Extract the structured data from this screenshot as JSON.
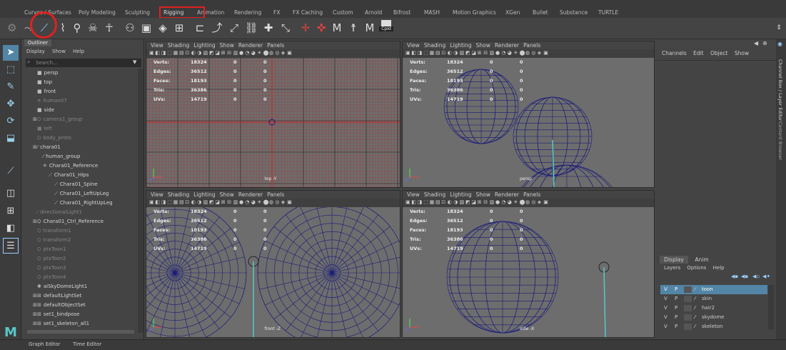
{
  "shelf_tabs": [
    "Curves / Surfaces",
    "Poly Modeling",
    "Sculpting",
    "Rigging",
    "Animation",
    "Rendering",
    "FX",
    "FX Caching",
    "Custom",
    "Arnold",
    "Bifrost",
    "MASH",
    "Motion Graphics",
    "XGen",
    "Bullet",
    "Substance",
    "TURTLE"
  ],
  "shelf_icons": {
    "cp_label": "CpId"
  },
  "outliner": {
    "tab": "Outliner",
    "menu": [
      "Display",
      "Show",
      "Help"
    ],
    "search_placeholder": "Search...",
    "items": [
      {
        "label": "persp",
        "dim": false,
        "indent": 1
      },
      {
        "label": "top",
        "dim": false,
        "indent": 1
      },
      {
        "label": "front",
        "dim": false,
        "indent": 1
      },
      {
        "label": "human07",
        "dim": true,
        "indent": 1
      },
      {
        "label": "side",
        "dim": false,
        "indent": 1
      },
      {
        "label": "camera1_group",
        "dim": true,
        "indent": 1
      },
      {
        "label": "left",
        "dim": true,
        "indent": 1
      },
      {
        "label": "body_proto",
        "dim": true,
        "indent": 1
      },
      {
        "label": "chara01",
        "dim": false,
        "indent": 1
      },
      {
        "label": "human_group",
        "dim": false,
        "indent": 2
      },
      {
        "label": "Chara01_Reference",
        "dim": false,
        "indent": 2
      },
      {
        "label": "Chara01_Hips",
        "dim": false,
        "indent": 3
      },
      {
        "label": "Chara01_Spine",
        "dim": false,
        "indent": 4
      },
      {
        "label": "Chara01_LeftUpLeg",
        "dim": false,
        "indent": 4
      },
      {
        "label": "Chara01_RightUpLeg",
        "dim": false,
        "indent": 4
      },
      {
        "label": "directionalLight1",
        "dim": true,
        "indent": 1
      },
      {
        "label": "Chara01_Ctrl_Reference",
        "dim": false,
        "indent": 1
      },
      {
        "label": "transform1",
        "dim": true,
        "indent": 1
      },
      {
        "label": "transform2",
        "dim": true,
        "indent": 1
      },
      {
        "label": "ptxToon1",
        "dim": true,
        "indent": 1
      },
      {
        "label": "ptxToon2",
        "dim": true,
        "indent": 1
      },
      {
        "label": "ptxToon3",
        "dim": true,
        "indent": 1
      },
      {
        "label": "ptxToon4",
        "dim": true,
        "indent": 1
      },
      {
        "label": "aiSkyDomeLight1",
        "dim": false,
        "indent": 1
      },
      {
        "label": "defaultLightSet",
        "dim": false,
        "indent": 1
      },
      {
        "label": "defaultObjectSet",
        "dim": false,
        "indent": 1
      },
      {
        "label": "set1_bindpose",
        "dim": false,
        "indent": 1
      },
      {
        "label": "set1_skeleton_all1",
        "dim": false,
        "indent": 1
      }
    ]
  },
  "viewport_menu": [
    "View",
    "Shading",
    "Lighting",
    "Show",
    "Renderer",
    "Panels"
  ],
  "hud": {
    "labels": [
      "Verts:",
      "Edges:",
      "Faces:",
      "Tris:",
      "UVs:"
    ],
    "values": [
      "18324",
      "36512",
      "18193",
      "36386",
      "14719"
    ],
    "zeros": "0"
  },
  "viewports": [
    {
      "name": "top -Y"
    },
    {
      "name": "persp"
    },
    {
      "name": "front -Z"
    },
    {
      "name": "side -X"
    }
  ],
  "channel_box": {
    "menu": [
      "Channels",
      "Edit",
      "Object",
      "Show"
    ]
  },
  "layer_editor": {
    "tabs": [
      "Display",
      "Anim"
    ],
    "menu": [
      "Layers",
      "Options",
      "Help"
    ],
    "layers": [
      {
        "v": "V",
        "p": "P",
        "name": "toon",
        "selected": true
      },
      {
        "v": "V",
        "p": "P",
        "name": "skin",
        "selected": false
      },
      {
        "v": "V",
        "p": "P",
        "name": "hair2",
        "selected": false
      },
      {
        "v": "V",
        "p": "P",
        "name": "skydome",
        "selected": false
      },
      {
        "v": "V",
        "p": "P",
        "name": "skeleton",
        "selected": false
      }
    ]
  },
  "right_tabs": [
    "Channel Box / Layer Editor",
    "Content Browser"
  ],
  "bottom_tabs": [
    "Graph Editor",
    "Time Editor"
  ],
  "colors": {
    "highlight_red": "#e02020",
    "layer_selected": "#5285a6",
    "wire": "#1a1a7a",
    "grid_red": "#b03030",
    "accent_cyan": "#59c8c8"
  }
}
